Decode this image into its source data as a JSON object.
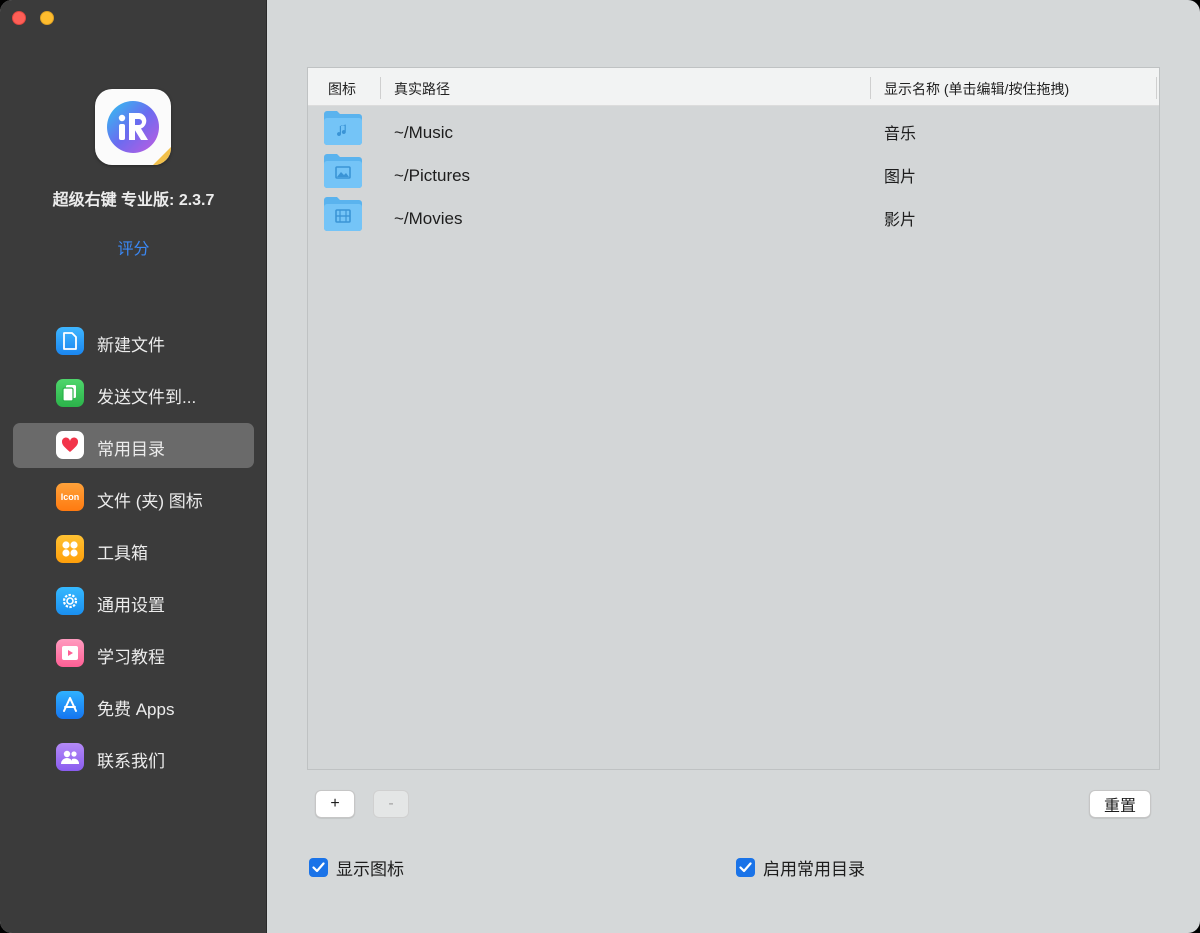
{
  "app": {
    "name": "超级右键 专业版: 2.3.7",
    "rate_label": "评分"
  },
  "sidebar": {
    "items": [
      {
        "label": "新建文件",
        "icon": "new-file-icon",
        "color": "#2b9bf4"
      },
      {
        "label": "发送文件到...",
        "icon": "send-file-icon",
        "color": "#34c759"
      },
      {
        "label": "常用目录",
        "icon": "heart-icon",
        "color": "#ffffff",
        "active": true
      },
      {
        "label": "文件 (夹) 图标",
        "icon": "icon-badge-icon",
        "color": "#ff8c1a"
      },
      {
        "label": "工具箱",
        "icon": "toolbox-icon",
        "color": "#ffb21a"
      },
      {
        "label": "通用设置",
        "icon": "gear-icon",
        "color": "#1ba1f2"
      },
      {
        "label": "学习教程",
        "icon": "tutorial-icon",
        "color": "#ff7aa8"
      },
      {
        "label": "免费 Apps",
        "icon": "app-store-icon",
        "color": "#1a8cf5"
      },
      {
        "label": "联系我们",
        "icon": "contact-icon",
        "color": "#9d6cf0"
      }
    ]
  },
  "table": {
    "columns": [
      "图标",
      "真实路径",
      "显示名称 (单击编辑/按住拖拽)"
    ],
    "rows": [
      {
        "icon": "music-folder-icon",
        "path": "~/Music",
        "name": "音乐"
      },
      {
        "icon": "pictures-folder-icon",
        "path": "~/Pictures",
        "name": "图片"
      },
      {
        "icon": "movies-folder-icon",
        "path": "~/Movies",
        "name": "影片"
      }
    ]
  },
  "buttons": {
    "add": "+",
    "remove": "-",
    "reset": "重置"
  },
  "options": {
    "show_icons": {
      "label": "显示图标",
      "checked": true
    },
    "enable_dirs": {
      "label": "启用常用目录",
      "checked": true
    }
  },
  "colors": {
    "accent": "#1a73e8",
    "link": "#3b88f5",
    "sidebar_bg": "#3b3b3b",
    "main_bg": "#d5d8d9"
  }
}
